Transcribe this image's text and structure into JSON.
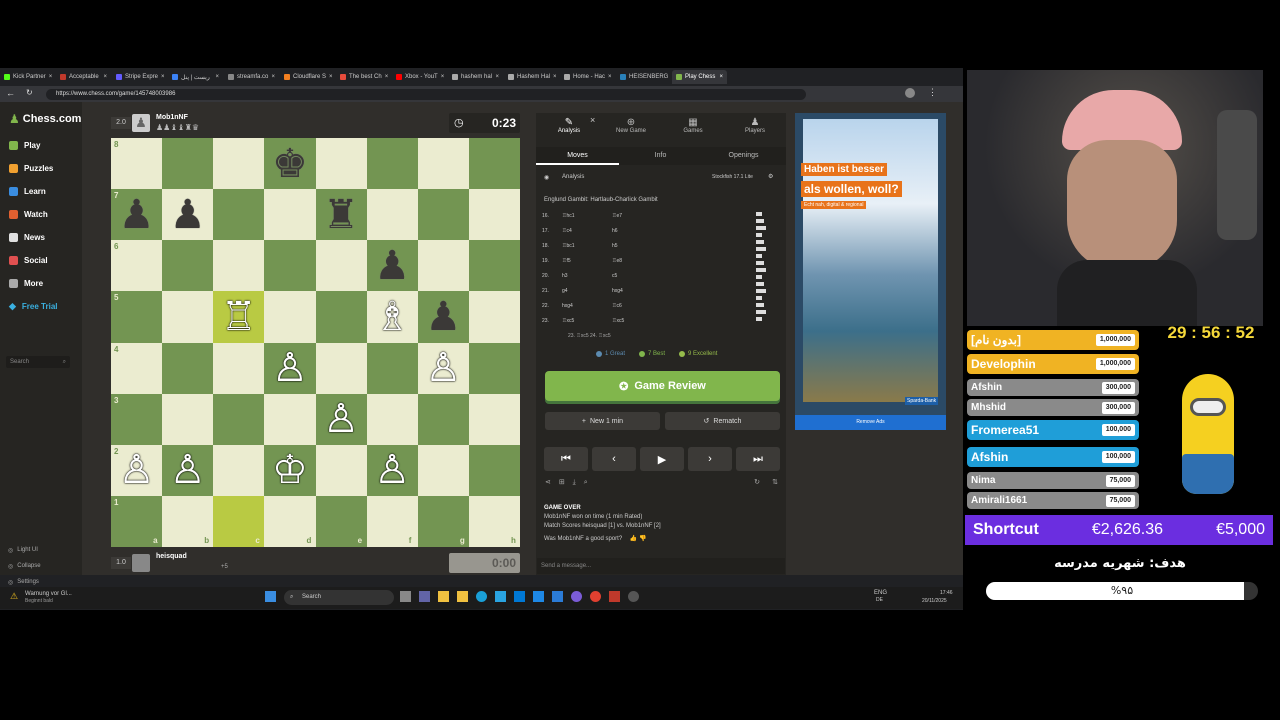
{
  "browser": {
    "tabs": [
      {
        "label": "Kick Partner",
        "color": "#53fc18"
      },
      {
        "label": "Acceptable",
        "color": "#c0392b"
      },
      {
        "label": "Stripe Expre",
        "color": "#635bff"
      },
      {
        "label": "ریست | پنل",
        "color": "#3b82f6"
      },
      {
        "label": "streamfa.co",
        "color": "#888888"
      },
      {
        "label": "Cloudflare S",
        "color": "#f38020"
      },
      {
        "label": "The best Ch",
        "color": "#e74c3c"
      },
      {
        "label": "Xbox - YouT",
        "color": "#ff0000"
      },
      {
        "label": "hashem hal",
        "color": "#aaaaaa"
      },
      {
        "label": "Hashem Hal",
        "color": "#aaaaaa"
      },
      {
        "label": "Home - Hac",
        "color": "#aaaaaa"
      },
      {
        "label": "HEISENBERG",
        "color": "#2980b9"
      },
      {
        "label": "Play Chess",
        "color": "#81b64c",
        "active": true
      }
    ],
    "url": "https://www.chess.com/game/145748003986"
  },
  "sidebar": {
    "logo": "Chess.com",
    "badge": "1",
    "items": [
      {
        "label": "Play",
        "color": "#81b64c"
      },
      {
        "label": "Puzzles",
        "color": "#f0a030"
      },
      {
        "label": "Learn",
        "color": "#3a8de0"
      },
      {
        "label": "Watch",
        "color": "#e06030"
      },
      {
        "label": "News",
        "color": "#e0e0e0"
      },
      {
        "label": "Social",
        "color": "#e05050"
      },
      {
        "label": "More",
        "color": "#aaaaaa"
      }
    ],
    "free_trial": "Free Trial",
    "search_placeholder": "Search",
    "bottom": [
      "Light UI",
      "Collapse",
      "Settings",
      "Support"
    ]
  },
  "top_player": {
    "rating_diff": "2.0",
    "name": "Mob1nNF",
    "timer": "0:23",
    "captured": "♟♟♝♝♜♛"
  },
  "bottom_player": {
    "rating_diff": "1.0",
    "name": "heisquad",
    "extra": "+5",
    "timer": "0:00"
  },
  "board": {
    "ranks": [
      "8",
      "7",
      "6",
      "5",
      "4",
      "3",
      "2",
      "1"
    ],
    "files": [
      "a",
      "b",
      "c",
      "d",
      "e",
      "f",
      "g",
      "h"
    ],
    "pieces": [
      {
        "sq": "d8",
        "p": "♚",
        "c": "b"
      },
      {
        "sq": "a7",
        "p": "♟",
        "c": "b"
      },
      {
        "sq": "b7",
        "p": "♟",
        "c": "b"
      },
      {
        "sq": "e7",
        "p": "♜",
        "c": "b"
      },
      {
        "sq": "f6",
        "p": "♟",
        "c": "b"
      },
      {
        "sq": "c5",
        "p": "♖",
        "c": "w"
      },
      {
        "sq": "f5",
        "p": "♗",
        "c": "w"
      },
      {
        "sq": "g5",
        "p": "♟",
        "c": "b"
      },
      {
        "sq": "d4",
        "p": "♙",
        "c": "w"
      },
      {
        "sq": "g4",
        "p": "♙",
        "c": "w"
      },
      {
        "sq": "e3",
        "p": "♙",
        "c": "w"
      },
      {
        "sq": "a2",
        "p": "♙",
        "c": "w"
      },
      {
        "sq": "b2",
        "p": "♙",
        "c": "w"
      },
      {
        "sq": "d2",
        "p": "♔",
        "c": "w"
      },
      {
        "sq": "f2",
        "p": "♙",
        "c": "w"
      }
    ],
    "highlights": [
      "c5",
      "c1"
    ]
  },
  "panel": {
    "tabs": [
      "Analysis",
      "New Game",
      "Games",
      "Players"
    ],
    "subtabs": [
      "Moves",
      "Info",
      "Openings"
    ],
    "analysis_label": "Analysis",
    "engine": "Stockfish 17.1 Lite",
    "opening": "Englund Gambit: Hartlaub-Charlick Gambit",
    "moves": [
      {
        "n": "16.",
        "w": "♖hc1",
        "b": "♖e7"
      },
      {
        "n": "17.",
        "w": "♖c4",
        "b": "h6"
      },
      {
        "n": "18.",
        "w": "♖bc1",
        "b": "h5"
      },
      {
        "n": "19.",
        "w": "♖f5",
        "b": "♖e8"
      },
      {
        "n": "20.",
        "w": "h3",
        "b": "c5"
      },
      {
        "n": "21.",
        "w": "g4",
        "b": "hxg4"
      },
      {
        "n": "22.",
        "w": "hxg4",
        "b": "♖c6"
      },
      {
        "n": "23.",
        "w": "♖xc5",
        "b": "♖xc5"
      }
    ],
    "last_line": "23. ♖xc5 24. ♖xc5",
    "summary": [
      {
        "label": "1 Great",
        "color": "#5c8bb0"
      },
      {
        "label": "7 Best",
        "color": "#81b64c"
      },
      {
        "label": "9 Excellent",
        "color": "#96bc4b"
      }
    ],
    "review_label": "Game Review",
    "new_label": "New 1 min",
    "rematch_label": "Rematch",
    "chat": {
      "header": "GAME OVER",
      "line1": "Mob1nNF won on time (1 min Rated)",
      "line2": "Match Scores heisquad [1] vs. Mob1nNF [2]",
      "question": "Was Mob1nNF a good sport?",
      "placeholder": "Send a message..."
    }
  },
  "ad": {
    "line1": "Haben ist besser",
    "line2": "als wollen, woll?",
    "small": "Echt nah, digital & regional",
    "bank": "Sparda-Bank",
    "remove": "Remove Ads"
  },
  "taskbar": {
    "warning": "Warnung vor Gl...",
    "warning2": "Beginnt bald",
    "search": "Search",
    "lang": "ENG",
    "lang2": "DE",
    "time": "17:46",
    "date": "20/11/2025"
  },
  "stream": {
    "countdown": "29 : 56 : 52",
    "leaderboard": [
      {
        "name": "[بدون نام]",
        "value": "1,000,000",
        "color": "#f0b323"
      },
      {
        "name": "Develophin",
        "value": "1,000,000",
        "color": "#f0b323"
      },
      {
        "name": "Afshin",
        "value": "300,000",
        "color": "#8a8a8a"
      },
      {
        "name": "Mhshid",
        "value": "300,000",
        "color": "#8a8a8a"
      },
      {
        "name": "Fromerea51",
        "value": "100,000",
        "color": "#1f9ed8"
      },
      {
        "name": "Afshin",
        "value": "100,000",
        "color": "#1f9ed8"
      },
      {
        "name": "Nima",
        "value": "75,000",
        "color": "#8a8a8a"
      },
      {
        "name": "Amirali1661",
        "value": "75,000",
        "color": "#8a8a8a"
      }
    ],
    "shortcut_label": "Shortcut",
    "shortcut_amount": "€2,626.36",
    "shortcut_goal": "€5,000",
    "goal_title": "هدف: شهریه مدرسه",
    "goal_pct": "%۹۵",
    "goal_progress": 0.95
  }
}
